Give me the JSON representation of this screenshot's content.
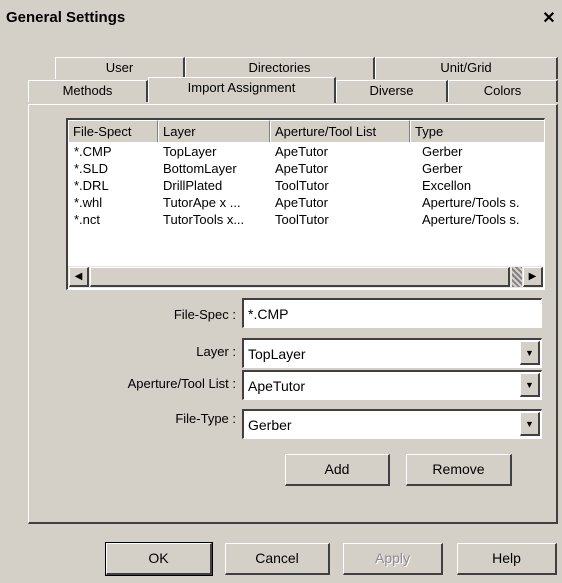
{
  "window": {
    "title": "General Settings",
    "close_glyph": "✕"
  },
  "tabs_back": [
    "User",
    "Directories",
    "Unit/Grid"
  ],
  "tabs_front": [
    "Methods",
    "Import Assignment",
    "Diverse",
    "Colors"
  ],
  "active_tab": "Import Assignment",
  "list": {
    "columns": [
      "File-Spect",
      "Layer",
      "Aperture/Tool List",
      "Type"
    ],
    "rows": [
      [
        "*.CMP",
        "TopLayer",
        "ApeTutor",
        "Gerber"
      ],
      [
        "*.SLD",
        "BottomLayer",
        "ApeTutor",
        "Gerber"
      ],
      [
        "*.DRL",
        "DrillPlated",
        "ToolTutor",
        "Excellon"
      ],
      [
        "*.whl",
        "TutorApe x ...",
        "ApeTutor",
        "Aperture/Tools s."
      ],
      [
        "*.nct",
        "TutorTools x...",
        "ToolTutor",
        "Aperture/Tools s."
      ]
    ],
    "scroll_left_icon": "◀",
    "scroll_right_icon": "▶"
  },
  "form": {
    "file_spec": {
      "label": "File-Spec :",
      "value": "*.CMP"
    },
    "layer": {
      "label": "Layer :",
      "value": "TopLayer"
    },
    "aperture": {
      "label": "Aperture/Tool List :",
      "value": "ApeTutor"
    },
    "file_type": {
      "label": "File-Type :",
      "value": "Gerber"
    },
    "dropdown_icon": "▼"
  },
  "actions": {
    "add": "Add",
    "remove": "Remove"
  },
  "footer": {
    "ok": "OK",
    "cancel": "Cancel",
    "apply": "Apply",
    "help": "Help"
  }
}
